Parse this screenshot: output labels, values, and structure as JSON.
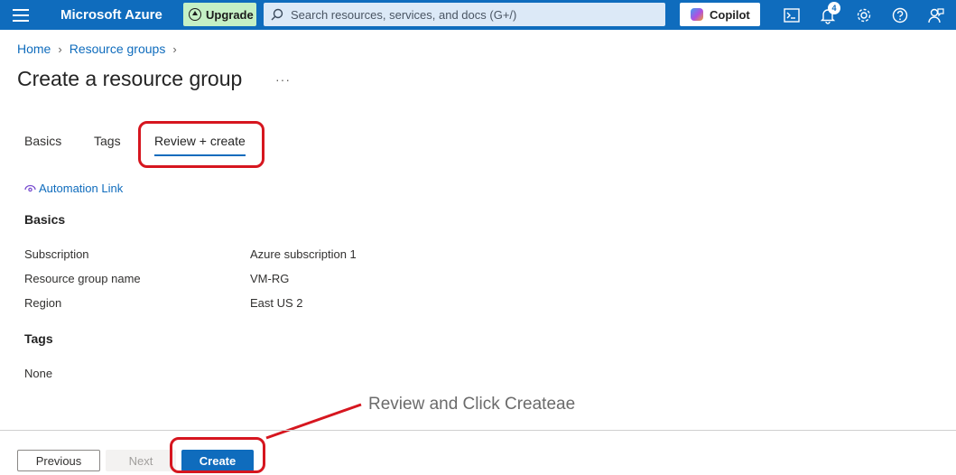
{
  "topbar": {
    "menu_icon": "hamburger-icon",
    "brand": "Microsoft Azure",
    "upgrade_label": "Upgrade",
    "search_placeholder": "Search resources, services, and docs (G+/)",
    "copilot_label": "Copilot",
    "notification_count": "4",
    "icons": [
      "cloud-shell-icon",
      "bell-icon",
      "gear-icon",
      "help-icon",
      "feedback-icon"
    ]
  },
  "breadcrumb": [
    "Home",
    "Resource groups"
  ],
  "page_title": "Create a resource group",
  "more_label": "···",
  "tabs": [
    {
      "label": "Basics",
      "active": false
    },
    {
      "label": "Tags",
      "active": false
    },
    {
      "label": "Review + create",
      "active": true
    }
  ],
  "automation_link": "Automation Link",
  "basics": {
    "heading": "Basics",
    "rows": [
      {
        "label": "Subscription",
        "value": "Azure subscription 1"
      },
      {
        "label": "Resource group name",
        "value": "VM-RG"
      },
      {
        "label": "Region",
        "value": "East US 2"
      }
    ]
  },
  "tags": {
    "heading": "Tags",
    "value": "None"
  },
  "annotation": "Review and Click Createae",
  "footer": {
    "previous_label": "Previous",
    "next_label": "Next",
    "create_label": "Create"
  },
  "colors": {
    "accent": "#0f6cbd",
    "annotation_red": "#d6161f"
  }
}
